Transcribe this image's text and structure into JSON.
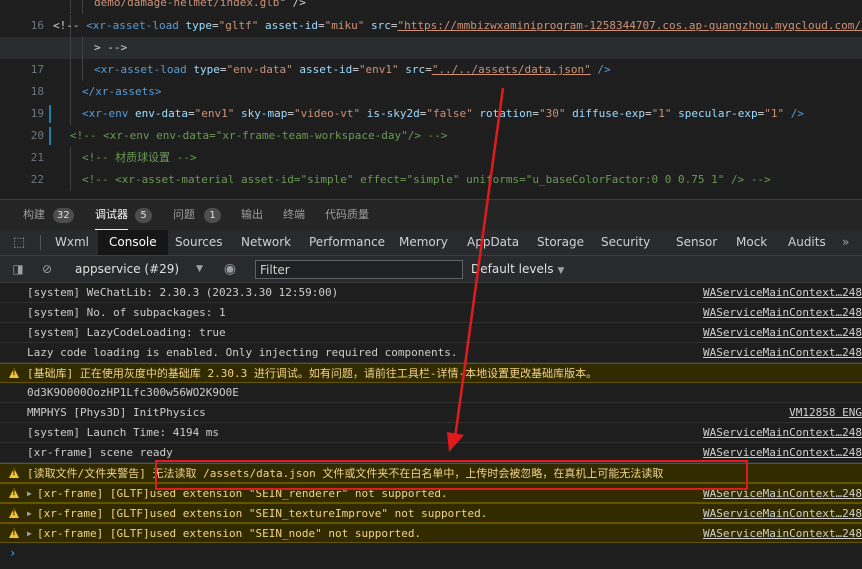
{
  "editor": {
    "lines": [
      {
        "num": "",
        "parts": [
          [
            "val",
            "demo/damage-helmet/index.glb"
          ],
          [
            "op",
            "\" />"
          ]
        ]
      },
      {
        "num": "16",
        "parts": [
          [
            "op",
            "<!--"
          ],
          [
            "tag",
            " <xr-asset-load"
          ],
          [
            "attr",
            " type"
          ],
          [
            "op",
            "="
          ],
          [
            "val",
            "\"gltf\""
          ],
          [
            "attr",
            " asset-id"
          ],
          [
            "op",
            "="
          ],
          [
            "val",
            "\"miku\""
          ],
          [
            "attr",
            " src"
          ],
          [
            "op",
            "="
          ],
          [
            "url",
            "\"https://mmbizwxaminiprogram-1258344707.cos.ap-guangzhou.myqcloud.com/xr-frame"
          ]
        ]
      },
      {
        "num": "",
        "parts": [
          [
            "op",
            "> -->"
          ]
        ]
      },
      {
        "num": "17",
        "parts": [
          [
            "tag",
            "<xr-asset-load"
          ],
          [
            "attr",
            " type"
          ],
          [
            "op",
            "="
          ],
          [
            "val",
            "\"env-data\""
          ],
          [
            "attr",
            " asset-id"
          ],
          [
            "op",
            "="
          ],
          [
            "val",
            "\"env1\""
          ],
          [
            "attr",
            " src"
          ],
          [
            "op",
            "="
          ],
          [
            "url",
            "\"../../assets/data.json\""
          ],
          [
            "tag",
            " />"
          ]
        ]
      },
      {
        "num": "18",
        "parts": [
          [
            "tag",
            "</xr-assets>"
          ]
        ]
      },
      {
        "num": "19",
        "parts": [
          [
            "tag",
            "<xr-env"
          ],
          [
            "attr",
            " env-data"
          ],
          [
            "op",
            "="
          ],
          [
            "val",
            "\"env1\""
          ],
          [
            "attr",
            " sky-map"
          ],
          [
            "op",
            "="
          ],
          [
            "val",
            "\"video-vt\""
          ],
          [
            "attr",
            " is-sky2d"
          ],
          [
            "op",
            "="
          ],
          [
            "val",
            "\"false\""
          ],
          [
            "attr",
            " rotation"
          ],
          [
            "op",
            "="
          ],
          [
            "val",
            "\"30\""
          ],
          [
            "attr",
            " diffuse-exp"
          ],
          [
            "op",
            "="
          ],
          [
            "val",
            "\"1\""
          ],
          [
            "attr",
            " specular-exp"
          ],
          [
            "op",
            "="
          ],
          [
            "val",
            "\"1\""
          ],
          [
            "tag",
            " />"
          ]
        ]
      },
      {
        "num": "20",
        "parts": [
          [
            "cm",
            "<!-- <xr-env env-data=\"xr-frame-team-workspace-day\"/> -->"
          ]
        ]
      },
      {
        "num": "21",
        "parts": [
          [
            "cm",
            "<!-- 材质球设置 -->"
          ]
        ]
      },
      {
        "num": "22",
        "parts": [
          [
            "cm",
            "<!-- <xr-asset-material asset-id=\"simple\" effect=\"simple\" uniforms=\"u_baseColorFactor:0 0 0.75 1\" /> -->"
          ]
        ]
      }
    ]
  },
  "panel_tabs": [
    {
      "label": "构建",
      "badge": "32"
    },
    {
      "label": "调试器",
      "badge": "5"
    },
    {
      "label": "问题",
      "badge": "1"
    },
    {
      "label": "输出",
      "badge": ""
    },
    {
      "label": "终端",
      "badge": ""
    },
    {
      "label": "代码质量",
      "badge": ""
    }
  ],
  "devtools_tabs": [
    "Wxml",
    "Console",
    "Sources",
    "Network",
    "Performance",
    "Memory",
    "AppData",
    "Storage",
    "Security",
    "Sensor",
    "Mock",
    "Audits"
  ],
  "devtools_more": "»",
  "toolbar": {
    "context": "appservice (#29)",
    "filter_placeholder": "Filter",
    "levels": "Default levels"
  },
  "console": {
    "messages": [
      {
        "type": "log",
        "text": "[system] WeChatLib: 2.30.3 (2023.3.30 12:59:00)",
        "source": "WAServiceMainContext…248"
      },
      {
        "type": "log",
        "text": "[system] No. of subpackages: 1",
        "source": "WAServiceMainContext…248"
      },
      {
        "type": "log",
        "text": "[system] LazyCodeLoading: true",
        "source": "WAServiceMainContext…248"
      },
      {
        "type": "log",
        "text": "Lazy code loading is enabled. Only injecting required components.",
        "source": "WAServiceMainContext…248"
      },
      {
        "type": "warn",
        "text": "[基础库] 正在使用灰度中的基础库 2.30.3 进行调试。如有问题，请前往工具栏-详情-本地设置更改基础库版本。",
        "source": ""
      },
      {
        "type": "log",
        "text": "0d3K9O000OozHP1Lfc300w56WO2K9O0E",
        "source": ""
      },
      {
        "type": "log",
        "text": "MMPHYS [Phys3D] InitPhysics",
        "source": "VM12858 ENG"
      },
      {
        "type": "log",
        "text": "[system] Launch Time: 4194 ms",
        "source": "WAServiceMainContext…248"
      },
      {
        "type": "log",
        "text": "[xr-frame] scene ready",
        "source": "WAServiceMainContext…248"
      },
      {
        "type": "warn",
        "text": "[读取文件/文件夹警告] 无法读取 /assets/data.json 文件或文件夹不在白名单中，上传时会被忽略，在真机上可能无法读取",
        "source": ""
      },
      {
        "type": "warn-exp",
        "text": "[xr-frame] [GLTF]used extension \"SEIN_renderer\" not supported.",
        "source": "WAServiceMainContext…248"
      },
      {
        "type": "warn-exp",
        "text": "[xr-frame] [GLTF]used extension \"SEIN_textureImprove\" not supported.",
        "source": "WAServiceMainContext…248"
      },
      {
        "type": "warn-exp",
        "text": "[xr-frame] [GLTF]used extension \"SEIN_node\" not supported.",
        "source": "WAServiceMainContext…248"
      }
    ],
    "prompt": "›"
  },
  "colors": {
    "annotation": "#e11b1b",
    "warning": "#f4c430",
    "console_active": "#161616"
  }
}
